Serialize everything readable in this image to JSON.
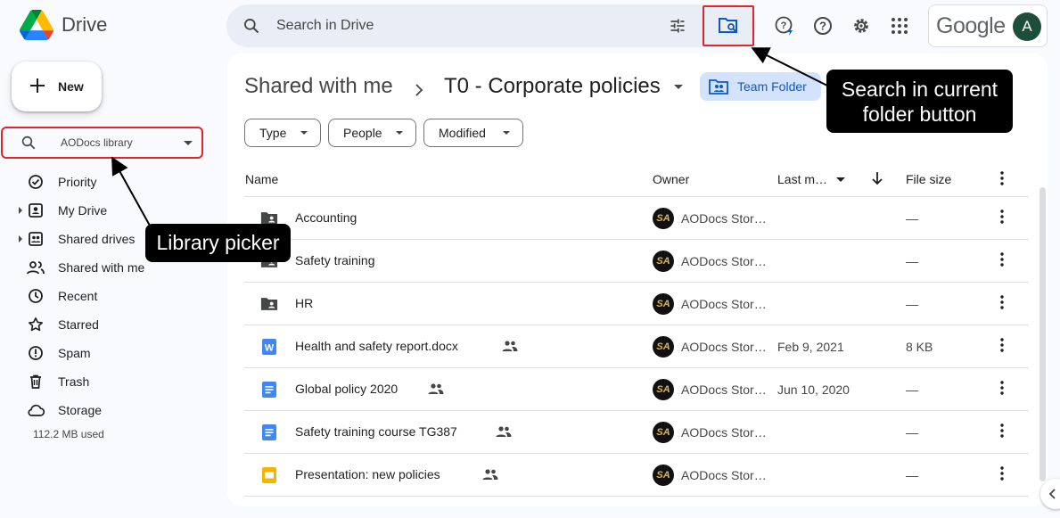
{
  "app": {
    "name": "Drive"
  },
  "search": {
    "placeholder": "Search in Drive"
  },
  "account": {
    "brand": "Google",
    "avatar_letter": "A"
  },
  "sidebar": {
    "new_label": "New",
    "library_picker": "AODocs library",
    "items": [
      {
        "label": "Priority",
        "icon": "priority-icon"
      },
      {
        "label": "My Drive",
        "icon": "my-drive-icon"
      },
      {
        "label": "Shared drives",
        "icon": "shared-drives-icon"
      },
      {
        "label": "Shared with me",
        "icon": "shared-with-me-icon"
      },
      {
        "label": "Recent",
        "icon": "clock-icon"
      },
      {
        "label": "Starred",
        "icon": "star-icon"
      },
      {
        "label": "Spam",
        "icon": "spam-icon"
      },
      {
        "label": "Trash",
        "icon": "trash-icon"
      },
      {
        "label": "Storage",
        "icon": "cloud-icon"
      }
    ],
    "storage_used": "112.2 MB used"
  },
  "breadcrumb": {
    "root": "Shared with me",
    "current": "T0 - Corporate policies",
    "chip": "Team Folder"
  },
  "filters": [
    "Type",
    "People",
    "Modified"
  ],
  "columns": {
    "name": "Name",
    "owner": "Owner",
    "modified": "Last m…",
    "size": "File size"
  },
  "rows": [
    {
      "name": "Accounting",
      "type": "shared-folder",
      "shared": false,
      "owner": "AODocs Stor…",
      "modified": "",
      "size": "—"
    },
    {
      "name": "Safety training",
      "type": "shared-folder",
      "shared": false,
      "owner": "AODocs Stor…",
      "modified": "",
      "size": "—"
    },
    {
      "name": "HR",
      "type": "shared-folder",
      "shared": false,
      "owner": "AODocs Stor…",
      "modified": "",
      "size": "—"
    },
    {
      "name": "Health and safety report.docx",
      "type": "word",
      "shared": true,
      "owner": "AODocs Stor…",
      "modified": "Feb 9, 2021",
      "size": "8 KB"
    },
    {
      "name": "Global policy 2020",
      "type": "doc",
      "shared": true,
      "owner": "AODocs Stor…",
      "modified": "Jun 10, 2020",
      "size": "—"
    },
    {
      "name": "Safety training course TG387",
      "type": "doc",
      "shared": true,
      "owner": "AODocs Stor…",
      "modified": "",
      "size": "—"
    },
    {
      "name": "Presentation: new policies",
      "type": "slides",
      "shared": true,
      "owner": "AODocs Stor…",
      "modified": "",
      "size": "—"
    }
  ],
  "annotations": {
    "library_picker": "Library picker",
    "search_folder": "Search in current folder button"
  },
  "colors": {
    "accent": "#0b57d0",
    "highlight_border": "#e5232b",
    "callout_bg": "#000000"
  }
}
